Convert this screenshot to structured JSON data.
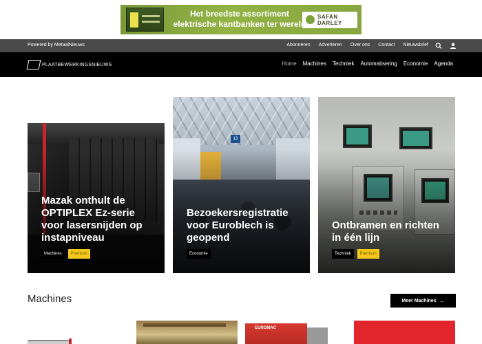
{
  "banner": {
    "line1": "Het breedste assortiment",
    "line2": "elektrische kantbanken ter wereld",
    "logo_line1": "SAFAN",
    "logo_line2": "DARLEY"
  },
  "utility": {
    "powered_by": "Powered by MetaalNieuws",
    "links": [
      "Abonneren",
      "Adverteren",
      "Over ons",
      "Contact",
      "Nieuwsbrief"
    ]
  },
  "site": {
    "logo_text": "PLAATBEWERKINGSNIEUWS"
  },
  "nav": {
    "items": [
      "Home",
      "Machines",
      "Techniek",
      "Automatisering",
      "Economie",
      "Agenda"
    ],
    "active": "Home"
  },
  "featured": [
    {
      "title": "Mazak onthult de OPTIPLEX Ez-serie voor lasersnijden op instapniveau",
      "tags": [
        "Machines",
        "Premium"
      ]
    },
    {
      "title": "Bezoekersregistratie voor Euroblech is geopend",
      "tags": [
        "Economie"
      ],
      "sign": "13"
    },
    {
      "title": "Ontbramen en richten in één lijn",
      "tags": [
        "Techniek",
        "Premium"
      ]
    }
  ],
  "machines_section": {
    "title": "Machines",
    "more_label": "Meer Machines",
    "thumb_label": "EUROMAC"
  },
  "colors": {
    "premium_tag": "#f3c71b",
    "nav_bg": "#000000",
    "utility_bg": "#4a4a4a"
  }
}
